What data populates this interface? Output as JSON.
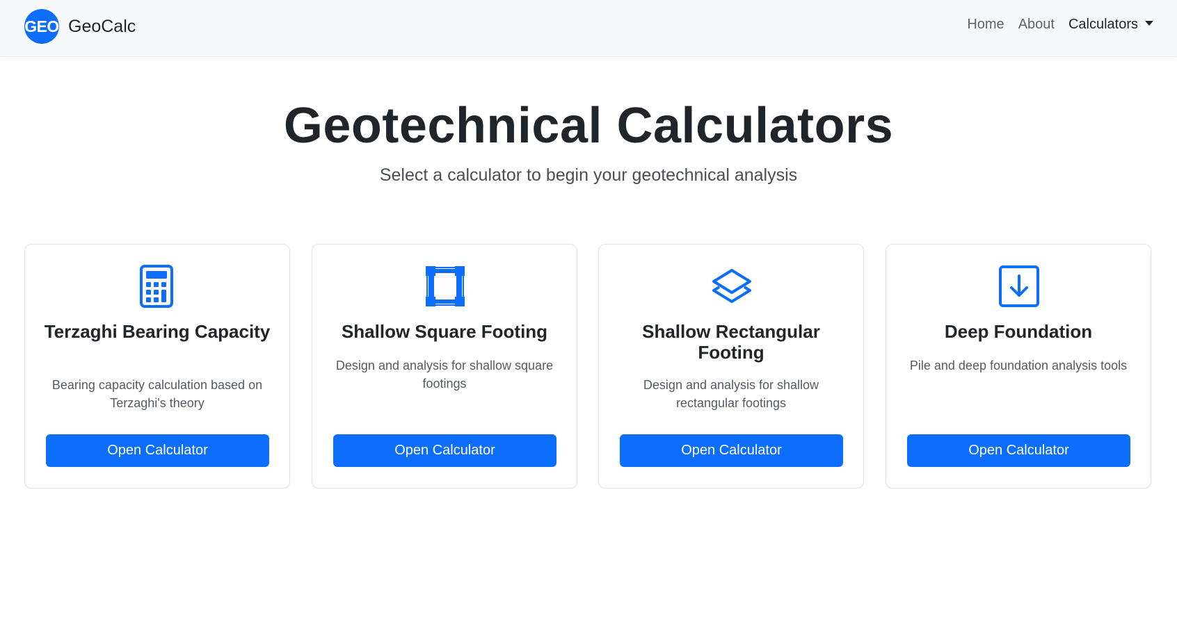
{
  "navbar": {
    "logo_text": "GEO",
    "brand_name": "GeoCalc",
    "links": [
      {
        "label": "Home"
      },
      {
        "label": "About"
      },
      {
        "label": "Calculators"
      }
    ]
  },
  "hero": {
    "title": "Geotechnical Calculators",
    "subtitle": "Select a calculator to begin your geotechnical analysis"
  },
  "cards": [
    {
      "icon": "calculator-icon",
      "title": "Terzaghi Bearing Capacity",
      "description": "Bearing capacity calculation based on Terzaghi's theory",
      "button_label": "Open Calculator"
    },
    {
      "icon": "bounding-box-icon",
      "title": "Shallow Square Footing",
      "description": "Design and analysis for shallow square footings",
      "button_label": "Open Calculator"
    },
    {
      "icon": "layers-icon",
      "title": "Shallow Rectangular Footing",
      "description": "Design and analysis for shallow rectangular footings",
      "button_label": "Open Calculator"
    },
    {
      "icon": "arrow-down-square-icon",
      "title": "Deep Foundation",
      "description": "Pile and deep foundation analysis tools",
      "button_label": "Open Calculator"
    }
  ],
  "colors": {
    "primary": "#0d6efd",
    "navbar_bg": "#f8f9fa",
    "text_dark": "#212529",
    "text_muted": "#555b61"
  }
}
